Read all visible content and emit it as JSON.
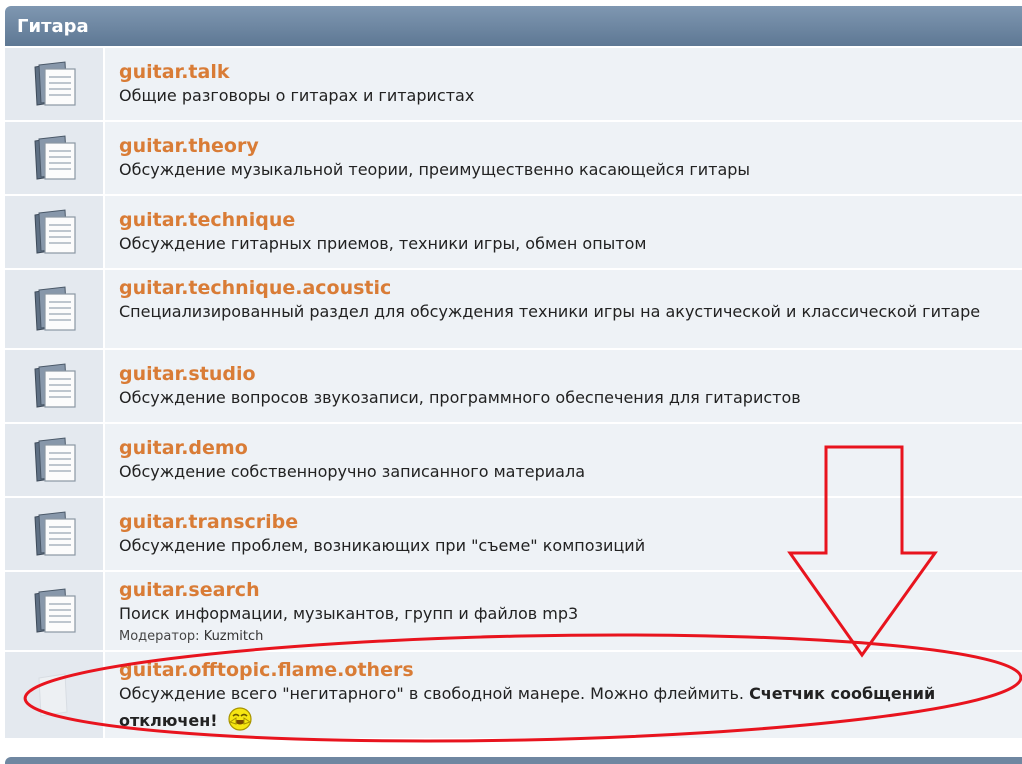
{
  "category": {
    "title": "Гитара"
  },
  "forums": [
    {
      "name": "guitar.talk",
      "description": "Общие разговоры о гитарах и гитаристах"
    },
    {
      "name": "guitar.theory",
      "description": "Обсуждение музыкальной теории, преимущественно касающейся гитары"
    },
    {
      "name": "guitar.technique",
      "description": "Обсуждение гитарных приемов, техники игры, обмен опытом"
    },
    {
      "name": "guitar.technique.acoustic",
      "description": "Специализированный раздел для обсуждения техники игры на акустической и классической гитаре"
    },
    {
      "name": "guitar.studio",
      "description": "Обсуждение вопросов звукозаписи, программного обеспечения для гитаристов"
    },
    {
      "name": "guitar.demo",
      "description": "Обсуждение собственноручно записанного материала"
    },
    {
      "name": "guitar.transcribe",
      "description": "Обсуждение проблем, возникающих при \"съеме\" композиций"
    },
    {
      "name": "guitar.search",
      "description": "Поиск информации, музыкантов, групп и файлов mp3",
      "moderator_label": "Модератор:",
      "moderator_name": "Kuzmitch"
    },
    {
      "name": "guitar.offtopic.flame.others",
      "description": "Обсуждение всего \"негитарного\" в свободной манере. Можно флеймить.",
      "note": "Счетчик сообщений отключен!"
    }
  ],
  "icons": {
    "forum": "forum-document-icon",
    "forum_inactive": "forum-no-icon",
    "smiley": "laughing-smiley-icon"
  },
  "colors": {
    "link": "#d97c36",
    "header": "#6f87a1",
    "annotation": "#e8141e"
  }
}
